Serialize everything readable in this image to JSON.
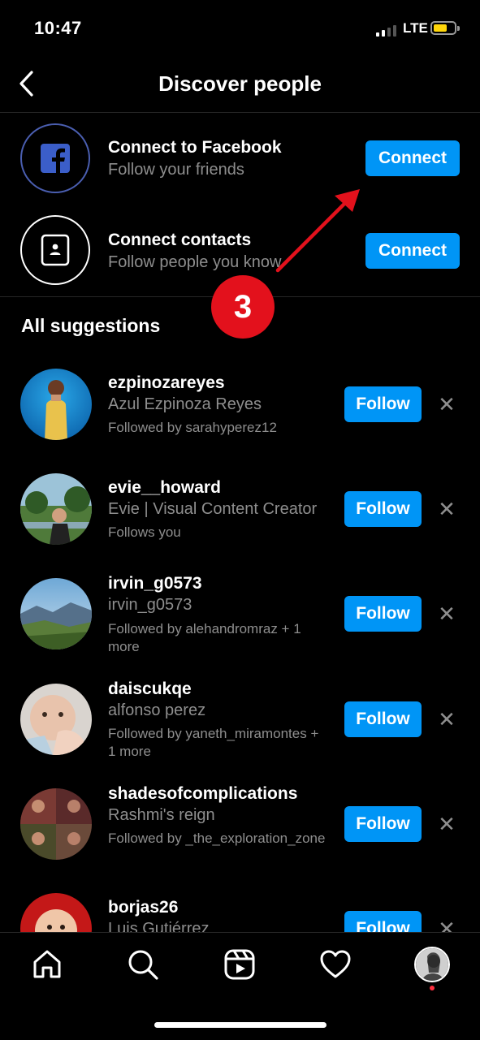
{
  "status_bar": {
    "time": "10:47",
    "network": "LTE",
    "battery_color": "#ffd60a"
  },
  "header": {
    "title": "Discover people",
    "back_icon": "chevron-left-icon"
  },
  "connect_items": [
    {
      "title": "Connect to Facebook",
      "subtitle": "Follow your friends",
      "button": "Connect",
      "icon": "facebook-icon"
    },
    {
      "title": "Connect contacts",
      "subtitle": "Follow people you know",
      "button": "Connect",
      "icon": "contacts-icon"
    }
  ],
  "annotation": {
    "step": "3",
    "color": "#e3111c"
  },
  "suggestions": {
    "title": "All suggestions",
    "follow_label": "Follow",
    "dismiss_label": "✕",
    "items": [
      {
        "username": "ezpinozareyes",
        "full_name": "Azul Ezpinoza Reyes",
        "context": "Followed by sarahyperez12"
      },
      {
        "username": "evie__howard",
        "full_name": "Evie | Visual Content Creator",
        "context": "Follows you"
      },
      {
        "username": "irvin_g0573",
        "full_name": "irvin_g0573",
        "context": "Followed by alehandromraz + 1 more"
      },
      {
        "username": "daiscukqe",
        "full_name": "alfonso perez",
        "context": "Followed by yaneth_miramontes + 1 more"
      },
      {
        "username": "shadesofcomplications",
        "full_name": "Rashmi's reign",
        "context": "Followed by _the_exploration_zone"
      },
      {
        "username": "borjas26",
        "full_name": "Luis Gutiérrez",
        "context": ""
      }
    ]
  },
  "tab_bar": {
    "items": [
      "home-icon",
      "search-icon",
      "reels-icon",
      "activity-heart-icon",
      "profile-avatar"
    ],
    "accent": "#0095f6",
    "notification_dot": "#ff3040"
  }
}
